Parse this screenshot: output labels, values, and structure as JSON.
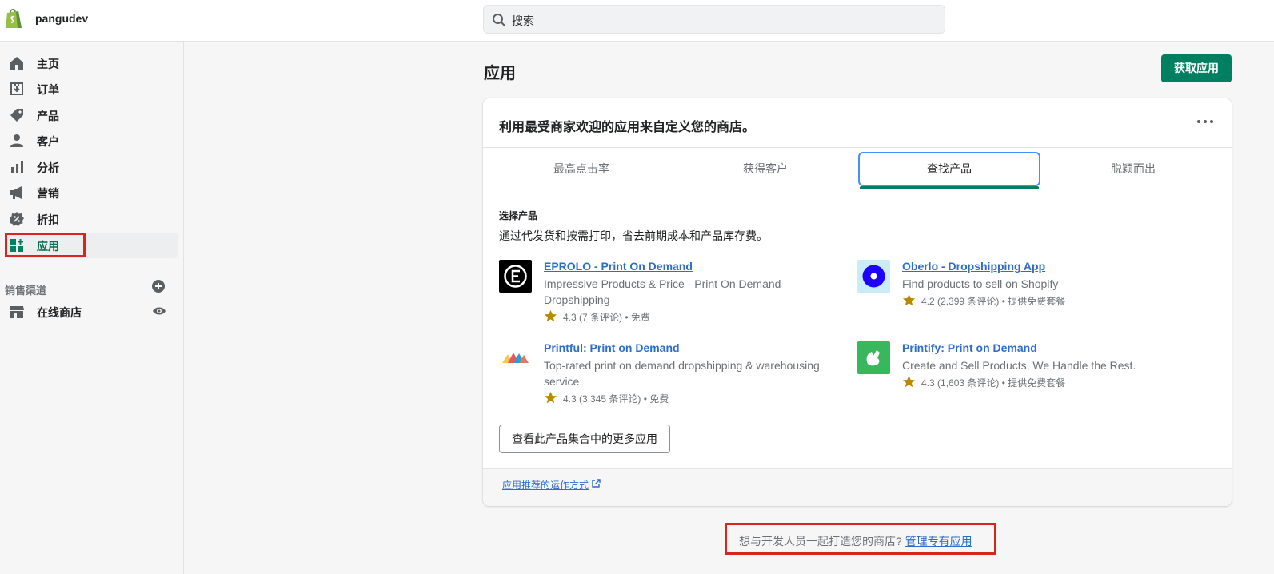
{
  "header": {
    "store_name": "pangudev",
    "search_placeholder": "搜索",
    "logo_icon": "shopify-bag-icon"
  },
  "sidebar": {
    "items": [
      {
        "label": "主页",
        "icon": "home-icon"
      },
      {
        "label": "订单",
        "icon": "orders-icon"
      },
      {
        "label": "产品",
        "icon": "tag-icon"
      },
      {
        "label": "客户",
        "icon": "person-icon"
      },
      {
        "label": "分析",
        "icon": "bar-chart-icon"
      },
      {
        "label": "营销",
        "icon": "megaphone-icon"
      },
      {
        "label": "折扣",
        "icon": "discount-icon"
      },
      {
        "label": "应用",
        "icon": "apps-icon",
        "active": true
      }
    ],
    "sales_channels_title": "销售渠道",
    "channels": [
      {
        "label": "在线商店",
        "icon": "store-icon"
      }
    ]
  },
  "main": {
    "page_title": "应用",
    "primary_action": "获取应用",
    "card": {
      "title": "利用最受商家欢迎的应用来自定义您的商店。",
      "tabs": [
        "最高点击率",
        "获得客户",
        "查找产品",
        "脱颖而出"
      ],
      "selected_tab": "查找产品",
      "section_heading": "选择产品",
      "section_desc": "通过代发货和按需打印，省去前期成本和产品库存费。",
      "apps": [
        {
          "name": "EPROLO - Print On Demand",
          "desc": "Impressive Products & Price - Print On Demand Dropshipping",
          "rating": "4.3",
          "reviews": "(7 条评论)",
          "price": "• 免费"
        },
        {
          "name": "Oberlo - Dropshipping App",
          "desc": "Find products to sell on Shopify",
          "rating": "4.2",
          "reviews": "(2,399 条评论)",
          "price": "• 提供免费套餐"
        },
        {
          "name": "Printful: Print on Demand",
          "desc": "Top-rated print on demand dropshipping & warehousing service",
          "rating": "4.3",
          "reviews": "(3,345 条评论)",
          "price": "• 免费"
        },
        {
          "name": "Printify: Print on Demand",
          "desc": "Create and Sell Products, We Handle the Rest.",
          "rating": "4.3",
          "reviews": "(1,603 条评论)",
          "price": "• 提供免费套餐"
        }
      ],
      "more_button": "查看此产品集合中的更多应用",
      "footer_link": "应用推荐的运作方式"
    },
    "bottom_note": "想与开发人员一起打造您的商店?",
    "bottom_link": "管理专有应用"
  },
  "colors": {
    "primary": "#008060",
    "link": "#2c6ecb",
    "highlight_box": "#d9251d",
    "star": "#b98900"
  }
}
